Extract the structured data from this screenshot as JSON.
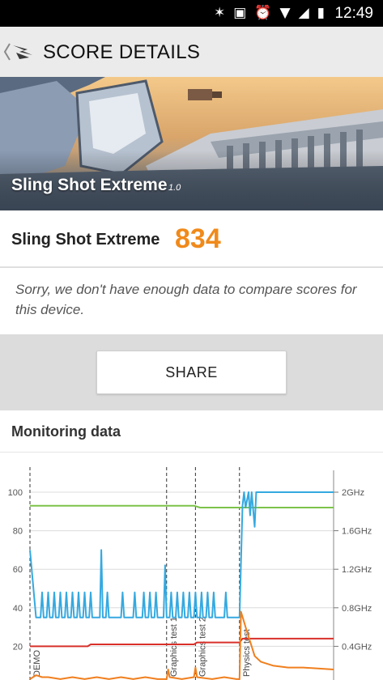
{
  "status_bar": {
    "time": "12:49",
    "icons": [
      "bluetooth-icon",
      "nfc-icon",
      "alarm-icon",
      "wifi-icon",
      "signal-icon",
      "battery-icon"
    ]
  },
  "app_bar": {
    "title": "SCORE DETAILS",
    "back_icon": "back-chevron-logo-icon"
  },
  "hero": {
    "title": "Sling Shot Extreme",
    "version": "1.0"
  },
  "score": {
    "name": "Sling Shot Extreme",
    "value": "834",
    "value_color": "#f08a1a"
  },
  "message": "Sorry, we don't have enough data to compare scores for this device.",
  "share_label": "SHARE",
  "monitoring": {
    "title": "Monitoring data"
  },
  "chart_data": {
    "type": "line",
    "left_axis": {
      "ticks": [
        "100",
        "80",
        "60",
        "40",
        "20"
      ],
      "range": [
        0,
        100
      ]
    },
    "right_axis": {
      "ticks": [
        "2GHz",
        "1.6GHz",
        "1.2GHz",
        "0.8GHz",
        "0.4GHz"
      ],
      "range": [
        0,
        2.0
      ]
    },
    "segments": [
      "DEMO",
      "Graphics test 1",
      "Graphics test 2",
      "Physics test"
    ],
    "segment_x": [
      0,
      0.45,
      0.545,
      0.69
    ],
    "series": [
      {
        "color": "#7cc24a",
        "x": [
          0,
          0.54,
          0.56,
          0.69,
          0.71,
          0.78,
          1
        ],
        "y": [
          93,
          93,
          92,
          92,
          92,
          92,
          92
        ]
      },
      {
        "color": "#d8302a",
        "x": [
          0,
          0.19,
          0.2,
          0.54,
          0.55,
          0.69,
          0.7,
          1
        ],
        "y": [
          20,
          20,
          21,
          21,
          22,
          22,
          24,
          24
        ]
      },
      {
        "color": "#35a9e0",
        "x": [
          0,
          0.02,
          0.035,
          0.04,
          0.045,
          0.055,
          0.06,
          0.065,
          0.075,
          0.08,
          0.085,
          0.095,
          0.1,
          0.105,
          0.115,
          0.12,
          0.125,
          0.135,
          0.14,
          0.145,
          0.155,
          0.16,
          0.165,
          0.175,
          0.18,
          0.185,
          0.195,
          0.2,
          0.205,
          0.23,
          0.235,
          0.24,
          0.25,
          0.255,
          0.26,
          0.3,
          0.305,
          0.31,
          0.34,
          0.345,
          0.35,
          0.37,
          0.375,
          0.38,
          0.39,
          0.395,
          0.4,
          0.41,
          0.415,
          0.42,
          0.44,
          0.445,
          0.45,
          0.46,
          0.465,
          0.47,
          0.48,
          0.485,
          0.49,
          0.5,
          0.505,
          0.51,
          0.52,
          0.525,
          0.53,
          0.54,
          0.545,
          0.55,
          0.56,
          0.565,
          0.57,
          0.58,
          0.585,
          0.59,
          0.6,
          0.605,
          0.61,
          0.64,
          0.645,
          0.65,
          0.68,
          0.685,
          0.69,
          0.7,
          0.705,
          0.71,
          0.72,
          0.725,
          0.73,
          0.74,
          0.745,
          0.76,
          1
        ],
        "y": [
          70,
          35,
          35,
          48,
          35,
          35,
          48,
          35,
          35,
          48,
          35,
          35,
          48,
          35,
          35,
          48,
          35,
          35,
          48,
          35,
          35,
          48,
          35,
          35,
          48,
          35,
          35,
          48,
          35,
          35,
          70,
          35,
          35,
          48,
          35,
          35,
          48,
          35,
          35,
          48,
          35,
          35,
          48,
          35,
          35,
          48,
          35,
          35,
          48,
          35,
          35,
          62,
          35,
          35,
          48,
          35,
          35,
          48,
          35,
          35,
          48,
          35,
          35,
          48,
          35,
          35,
          48,
          35,
          35,
          48,
          35,
          35,
          48,
          35,
          35,
          48,
          35,
          35,
          48,
          35,
          35,
          35,
          35,
          93,
          100,
          92,
          100,
          88,
          100,
          82,
          100,
          100,
          100
        ]
      },
      {
        "color": "#f07f1e",
        "x": [
          0,
          0.02,
          0.04,
          0.06,
          0.1,
          0.14,
          0.18,
          0.22,
          0.26,
          0.3,
          0.34,
          0.38,
          0.42,
          0.45,
          0.455,
          0.46,
          0.5,
          0.54,
          0.545,
          0.55,
          0.6,
          0.64,
          0.68,
          0.69,
          0.695,
          0.71,
          0.72,
          0.73,
          0.74,
          0.76,
          0.8,
          0.85,
          0.9,
          1
        ],
        "y": [
          3,
          5,
          4,
          4,
          3,
          4,
          3,
          4,
          3,
          4,
          3,
          4,
          3,
          3,
          8,
          4,
          3,
          4,
          9,
          4,
          3,
          4,
          3,
          3,
          38,
          30,
          25,
          20,
          15,
          12,
          10,
          9,
          9,
          8
        ]
      }
    ]
  }
}
